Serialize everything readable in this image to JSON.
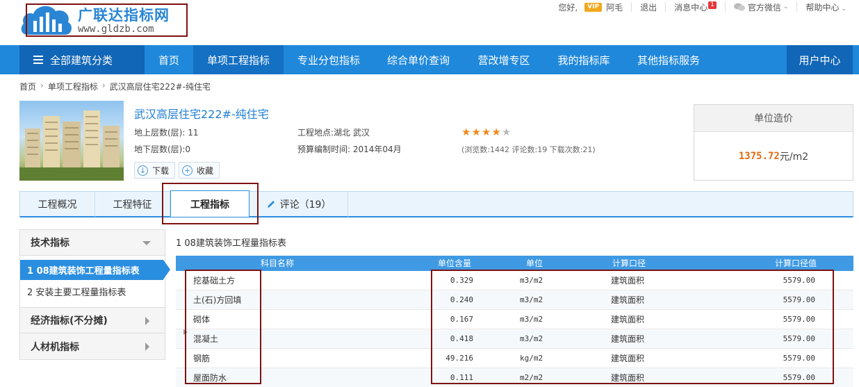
{
  "header": {
    "logo_title": "广联达指标网",
    "logo_url": "www.gldzb.com",
    "greeting": "您好,",
    "vip": "VIP",
    "username": "阿毛",
    "logout": "退出",
    "messages": "消息中心",
    "message_count": "1",
    "wechat": "官方微信",
    "help": "帮助中心"
  },
  "nav": {
    "all_categories": "全部建筑分类",
    "items": [
      "首页",
      "单项工程指标",
      "专业分包指标",
      "综合单价查询",
      "营改增专区",
      "我的指标库",
      "其他指标服务"
    ],
    "active_index": 1,
    "user_center": "用户中心"
  },
  "breadcrumb": [
    "首页",
    "单项工程指标",
    "武汉高层住宅222#-纯住宅"
  ],
  "project": {
    "title": "武汉高层住宅222#-纯住宅",
    "floors_above": "地上层数(层): 11",
    "floors_below": "地下层数(层):0",
    "location": "工程地点:湖北 武汉",
    "budget_time": "预算编制时间: 2014年04月",
    "rating": 4,
    "rating_max": 5,
    "stats": "(浏览数:1442   评论数:19   下载次数:21)",
    "download": "下载",
    "favorite": "收藏"
  },
  "price": {
    "label": "单位造价",
    "value": "1375.72",
    "unit": "元/m2"
  },
  "tabs": [
    "工程概况",
    "工程特征",
    "工程指标",
    "评论（19）"
  ],
  "active_tab": 2,
  "sidebar": {
    "tech_header": "技术指标",
    "tech_items": [
      "1 08建筑装饰工程量指标表",
      "2 安装主要工程量指标表"
    ],
    "econ_header": "经济指标(不分摊)",
    "material_header": "人材机指标"
  },
  "table": {
    "title": "1 08建筑装饰工程量指标表",
    "headers": [
      "科目名称",
      "单位含量",
      "单位",
      "计算口径",
      "计算口径值"
    ],
    "rows": [
      [
        "挖基础土方",
        "0.329",
        "m3/m2",
        "建筑面积",
        "5579.00"
      ],
      [
        "土(石)方回填",
        "0.240",
        "m3/m2",
        "建筑面积",
        "5579.00"
      ],
      [
        "砌体",
        "0.167",
        "m3/m2",
        "建筑面积",
        "5579.00"
      ],
      [
        "混凝土",
        "0.418",
        "m3/m2",
        "建筑面积",
        "5579.00"
      ],
      [
        "钢筋",
        "49.216",
        "kg/m2",
        "建筑面积",
        "5579.00"
      ],
      [
        "屋面防水",
        "0.111",
        "m2/m2",
        "建筑面积",
        "5579.00"
      ]
    ]
  },
  "colors": {
    "brand_blue": "#1f88db",
    "price_orange": "#e06b12",
    "highlight_red": "#7d1212"
  }
}
